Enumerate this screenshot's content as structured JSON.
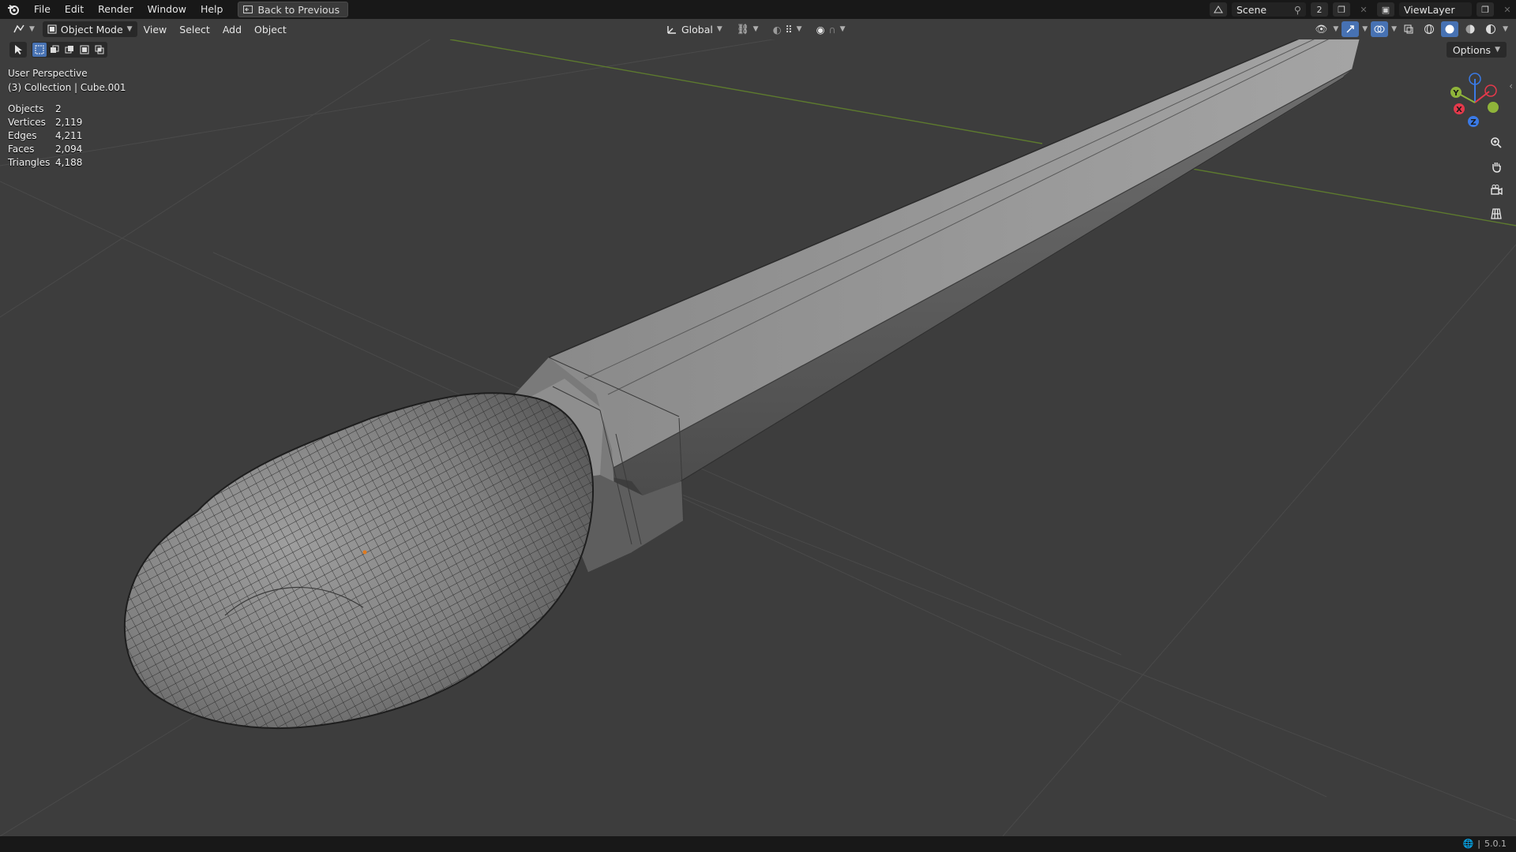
{
  "menubar": {
    "items": [
      "File",
      "Edit",
      "Render",
      "Window",
      "Help"
    ],
    "back_button": "Back to Previous"
  },
  "scene": {
    "name": "Scene",
    "count": "2",
    "view_layer": "ViewLayer"
  },
  "header": {
    "mode": "Object Mode",
    "menus": [
      "View",
      "Select",
      "Add",
      "Object"
    ],
    "orientation": "Global",
    "options_label": "Options"
  },
  "overlay": {
    "perspective": "User Perspective",
    "collection": "(3) Collection | Cube.001",
    "stats": [
      {
        "label": "Objects",
        "value": "2"
      },
      {
        "label": "Vertices",
        "value": "2,119"
      },
      {
        "label": "Edges",
        "value": "4,211"
      },
      {
        "label": "Faces",
        "value": "2,094"
      },
      {
        "label": "Triangles",
        "value": "4,188"
      }
    ]
  },
  "gizmo": {
    "x": "X",
    "y": "Y",
    "z": "Z"
  },
  "status": {
    "version": "5.0.1"
  },
  "colors": {
    "background": "#3d3d3d",
    "accent": "#4772b3",
    "axis_x": "#e5394b",
    "axis_y": "#8fb43a",
    "axis_z": "#3a7ae6"
  }
}
